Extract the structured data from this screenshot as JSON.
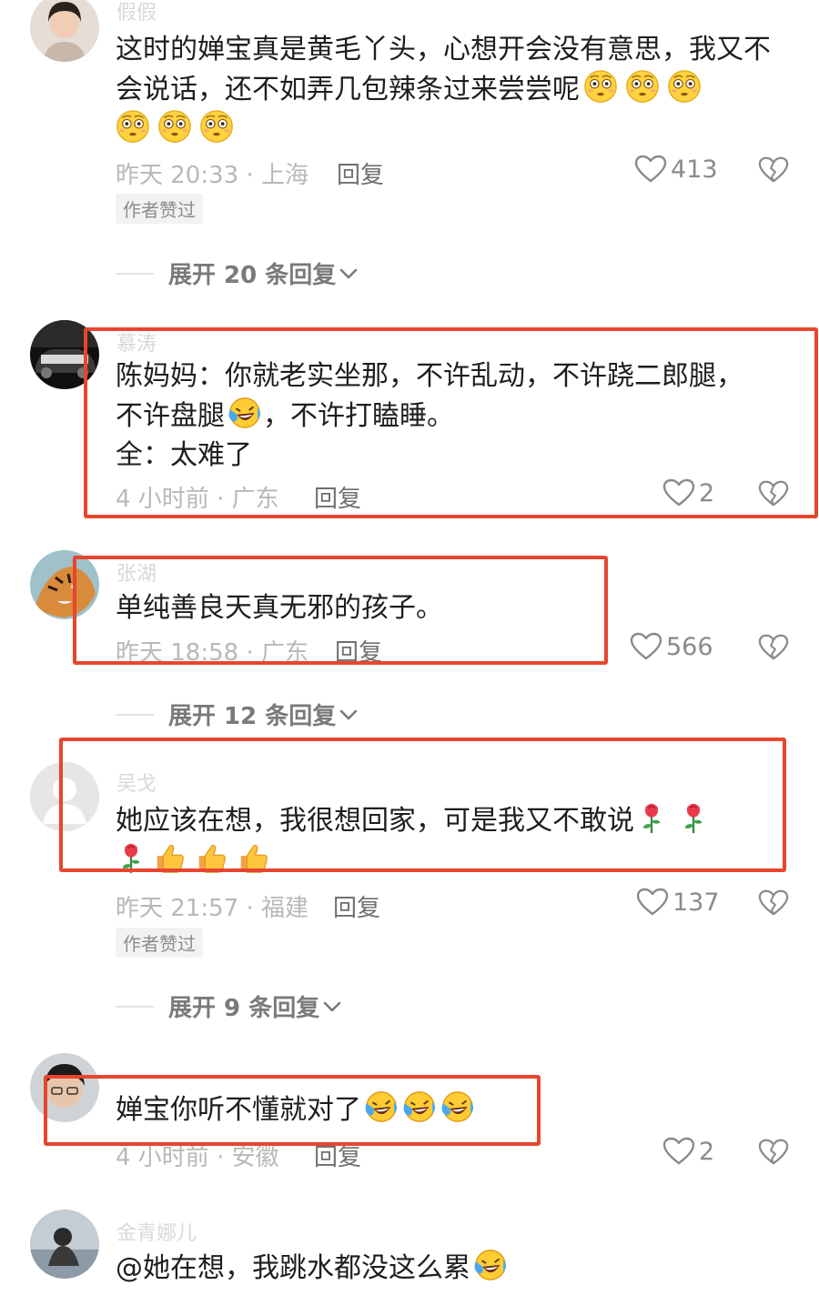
{
  "comments": [
    {
      "username": "假假",
      "text": "这时的婵宝真是黄毛丫头，心想开会没有意思，我又不会说话，还不如弄几包辣条过来尝尝呢",
      "emoji_count": 6,
      "meta": "昨天 20:33 · 上海",
      "reply_label": "回复",
      "likes": "413",
      "author_tag": "作者赞过",
      "expand": "展开 20 条回复"
    },
    {
      "username": "慕涛",
      "text_line1": "陈妈妈：你就老实坐那，不许乱动，不许跷二郎腿，",
      "text_line2": "不许盘腿",
      "text_line2b": "，不许打瞌睡。",
      "text_line3": "全：太难了",
      "meta": "4 小时前 · 广东",
      "reply_label": "回复",
      "likes": "2"
    },
    {
      "username": "张湖",
      "text": "单纯善良天真无邪的孩子。",
      "meta": "昨天 18:58 · 广东",
      "reply_label": "回复",
      "likes": "566",
      "expand": "展开 12 条回复"
    },
    {
      "username": "吴戈",
      "text": "她应该在想，我很想回家，可是我又不敢说",
      "meta": "昨天 21:57 · 福建",
      "reply_label": "回复",
      "likes": "137",
      "author_tag": "作者赞过",
      "expand": "展开 9 条回复"
    },
    {
      "text": "婵宝你听不懂就对了",
      "meta": "4 小时前 · 安徽",
      "reply_label": "回复",
      "likes": "2"
    },
    {
      "username": "金青娜儿",
      "text": "@她在想，我跳水都没这么累"
    }
  ],
  "colors": {
    "highlight": "#e8452f",
    "meta_text": "#b8b8b8",
    "body_text": "#1e1e1e"
  },
  "icons": [
    "heart-icon",
    "broken-heart-icon",
    "chevron-down-icon",
    "flushed-emoji",
    "laughing-crying-emoji",
    "rose-emoji",
    "thumbs-up-emoji"
  ]
}
